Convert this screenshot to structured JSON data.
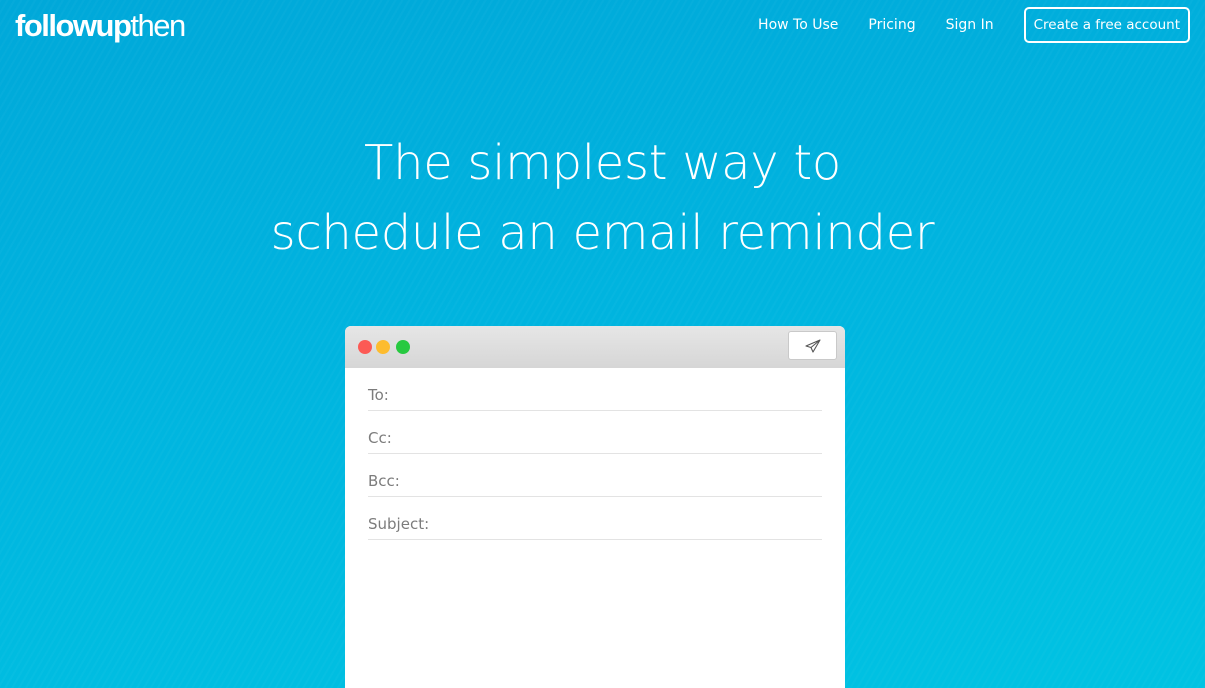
{
  "logo": {
    "part1": "followup",
    "part2": "then"
  },
  "nav": {
    "items": [
      {
        "label": "How To Use"
      },
      {
        "label": "Pricing"
      },
      {
        "label": "Sign In"
      }
    ],
    "cta_label": "Create a free account"
  },
  "hero": {
    "line1": "The simplest way to",
    "line2": "schedule an email reminder"
  },
  "composer": {
    "send_icon": "paper-plane-icon",
    "fields": [
      {
        "label": "To:"
      },
      {
        "label": "Cc:"
      },
      {
        "label": "Bcc:"
      },
      {
        "label": "Subject:"
      }
    ]
  },
  "colors": {
    "background": "#00b4df",
    "close": "#fc5a55",
    "minimize": "#fdbc2f",
    "maximize": "#27c940"
  }
}
